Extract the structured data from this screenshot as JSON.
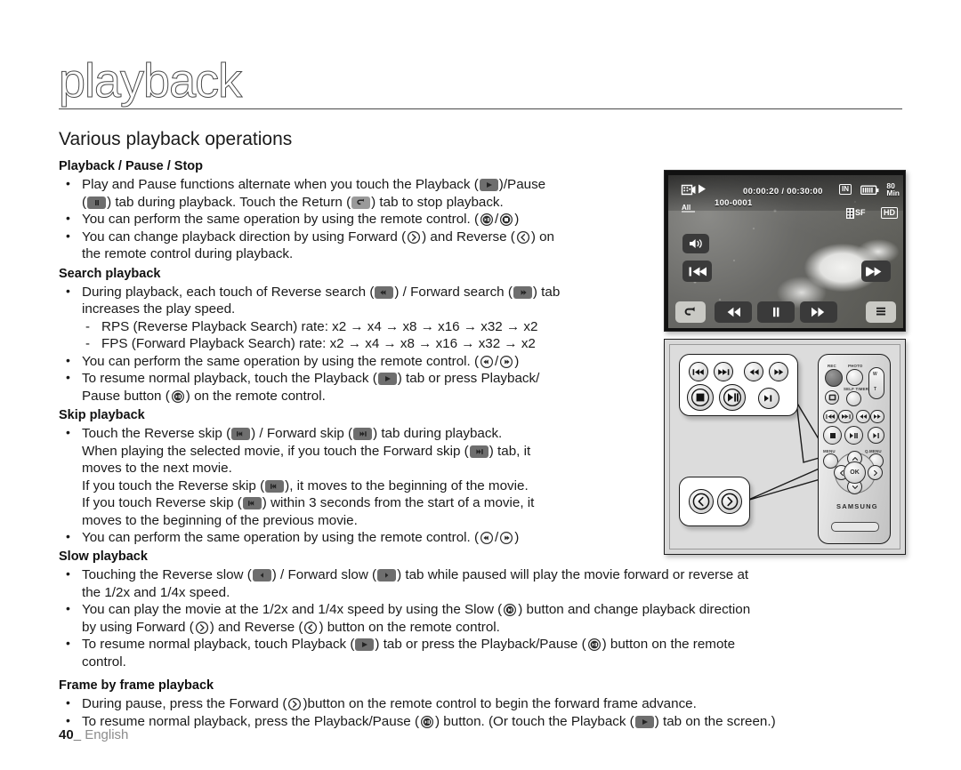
{
  "page": {
    "chapter_title": "playback",
    "section_title": "Various playback operations",
    "footer_page_number": "40",
    "footer_language": "English"
  },
  "sections": [
    {
      "heading": "Playback / Pause / Stop",
      "bullets": [
        "Play and Pause functions alternate when you touch the Playback (  )/Pause (  ) tab during playback. Touch the Return (  ) tab to stop playback.",
        "You can perform the same operation by using the remote control. (  /  )",
        "You can change playback direction by using Forward (  ) and Reverse (  ) on the remote control during playback."
      ]
    },
    {
      "heading": "Search playback",
      "bullets": [
        "During playback, each touch of Reverse search (  ) / Forward search (  ) tab increases the play speed.",
        "You can perform the same operation by using the remote control. (  /  )",
        "To resume normal playback, touch the Playback (  ) tab or press Playback/Pause button (  ) on the remote control."
      ],
      "sub_items": [
        "RPS (Reverse Playback Search) rate: x2 → x4 → x8 → x16 → x32 → x2",
        "FPS (Forward Playback Search) rate: x2 → x4 → x8 → x16 → x32 → x2"
      ]
    },
    {
      "heading": "Skip playback",
      "bullets": [
        "Touch the Reverse skip (  ) / Forward skip (  ) tab during playback.",
        "You can perform the same operation by using the remote control. (  /  )"
      ],
      "continuation_lines": [
        "When playing the selected movie, if you touch the Forward skip (  ) tab, it moves to the next movie.",
        "If you touch the Reverse skip (  ), it moves to the beginning of the movie.",
        "If you touch Reverse skip (  ) within 3 seconds from the start of a movie, it moves to the beginning of the previous movie."
      ]
    },
    {
      "heading": "Slow playback",
      "bullets": [
        "Touching the Reverse slow (  ) / Forward slow (  ) tab while paused will play the movie forward or reverse at the 1/2x and 1/4x speed.",
        "You can play the movie at the 1/2x and 1/4x speed by using the Slow (  ) button and change playback direction by using Forward (  ) and Reverse (  ) button on the remote control.",
        "To resume normal playback, touch Playback (  ) tab or press the Playback/Pause (  ) button on the remote control."
      ]
    },
    {
      "heading": "Frame by frame playback",
      "bullets": [
        "During pause, press the Forward (  )button on the remote control to begin the forward frame advance.",
        "To resume normal playback, press the Playback/Pause (  ) button. (Or touch the Playback (  ) tab on the screen.)"
      ]
    }
  ],
  "text_fragments": {
    "s1_b1_a": "Play and Pause functions alternate when you touch the Playback (",
    "s1_b1_b": ")/Pause",
    "s1_b1_c": "(",
    "s1_b1_d": ") tab during playback. Touch the Return (",
    "s1_b1_e": ") tab to stop playback.",
    "s1_b2_a": "You can perform the same operation by using the remote control. (",
    "s1_b2_b": "/",
    "s1_b2_c": ")",
    "s1_b3_a": "You can change playback direction by using Forward (",
    "s1_b3_b": ") and Reverse (",
    "s1_b3_c": ") on",
    "s1_b3_d": "the remote control during playback.",
    "s2_b1_a": "During playback, each touch of Reverse search (",
    "s2_b1_b": ") / Forward search (",
    "s2_b1_c": ") tab",
    "s2_b1_d": "increases the play speed.",
    "s2_d1": "RPS (Reverse Playback Search) rate: x2 → x4 → x8 → x16 → x32 → x2",
    "s2_d2": "FPS (Forward Playback Search) rate: x2 → x4 → x8 → x16 → x32 → x2",
    "s2_b2_a": "You can perform the same operation by using the remote control. (",
    "s2_b3_a": "To resume normal playback, touch the Playback (",
    "s2_b3_b": ") tab or press Playback/",
    "s2_b3_c": "Pause button (",
    "s2_b3_d": ") on the remote control.",
    "s3_b1_a": "Touch the Reverse skip (",
    "s3_b1_b": ") / Forward skip (",
    "s3_b1_c": ") tab during playback.",
    "s3_l1_a": "When playing the selected movie, if you touch the Forward skip (",
    "s3_l1_b": ") tab, it",
    "s3_l1_c": "moves to the next movie.",
    "s3_l2_a": "If you touch the Reverse skip (",
    "s3_l2_b": "), it moves to the beginning of the movie.",
    "s3_l3_a": "If you touch Reverse skip (",
    "s3_l3_b": ") within 3 seconds from the start of a movie, it",
    "s3_l3_c": "moves to the beginning of the previous movie.",
    "s3_b2_a": "You can perform the same operation by using the remote control. (",
    "s4_b1_a": "Touching the Reverse slow (",
    "s4_b1_b": ") / Forward slow (",
    "s4_b1_c": ") tab while paused will play the movie forward or reverse at",
    "s4_b1_d": "the 1/2x and 1/4x speed.",
    "s4_b2_a": "You can play the movie at the 1/2x and 1/4x speed by using the Slow (",
    "s4_b2_b": ") button and change playback direction",
    "s4_b2_c": "by using Forward (",
    "s4_b2_d": ") and Reverse (",
    "s4_b2_e": ") button on the remote control.",
    "s4_b3_a": "To resume normal playback, touch Playback (",
    "s4_b3_b": ") tab or press the Playback/Pause (",
    "s4_b3_c": ") button on the remote",
    "s4_b3_d": "control.",
    "s5_b1_a": "During pause, press the Forward (",
    "s5_b1_b": ")button on the remote control to begin the forward frame advance.",
    "s5_b2_a": "To resume normal playback, press the Playback/Pause (",
    "s5_b2_b": ") button. (Or touch the Playback (",
    "s5_b2_c": ") tab on the screen.)"
  },
  "lcd_screen": {
    "elapsed_total": "00:00:20 / 00:30:00",
    "file_number": "100-0001",
    "storage_badge": "IN",
    "battery_time": "80",
    "battery_unit": "Min",
    "quality_badge": "SF",
    "resolution_badge": "HD",
    "icons": {
      "movie_mode": "movie-mode-icon",
      "play_state": "play-icon",
      "all_play": "all-play-icon",
      "battery": "battery-icon",
      "volume": "volume-icon",
      "reverse_skip": "reverse-skip-tab",
      "forward_skip": "forward-skip-tab",
      "return": "return-tab",
      "reverse_search": "reverse-search-tab",
      "pause": "pause-tab",
      "forward_search": "forward-search-tab",
      "menu": "menu-tab"
    }
  },
  "remote": {
    "brand": "SAMSUNG",
    "labels": {
      "rec": "REC",
      "photo": "PHOTO",
      "self_timer": "SELF TIMER",
      "menu": "MENU",
      "q_menu": "Q.MENU",
      "ok": "OK",
      "zoom_wide": "W",
      "zoom_tele": "T"
    },
    "callout_top_buttons": [
      "reverse-skip-button",
      "forward-skip-button",
      "reverse-search-button",
      "forward-search-button",
      "stop-button",
      "playback-pause-button",
      "slow-button"
    ],
    "callout_bottom_buttons": [
      "reverse-direction-button",
      "forward-direction-button"
    ]
  },
  "colors": {
    "text": "#1a1a1a",
    "muted": "#8c8c8c",
    "tab_dark": "#6e6e6e",
    "tab_light": "#9a9a9a",
    "rule": "#4a4a4a"
  }
}
